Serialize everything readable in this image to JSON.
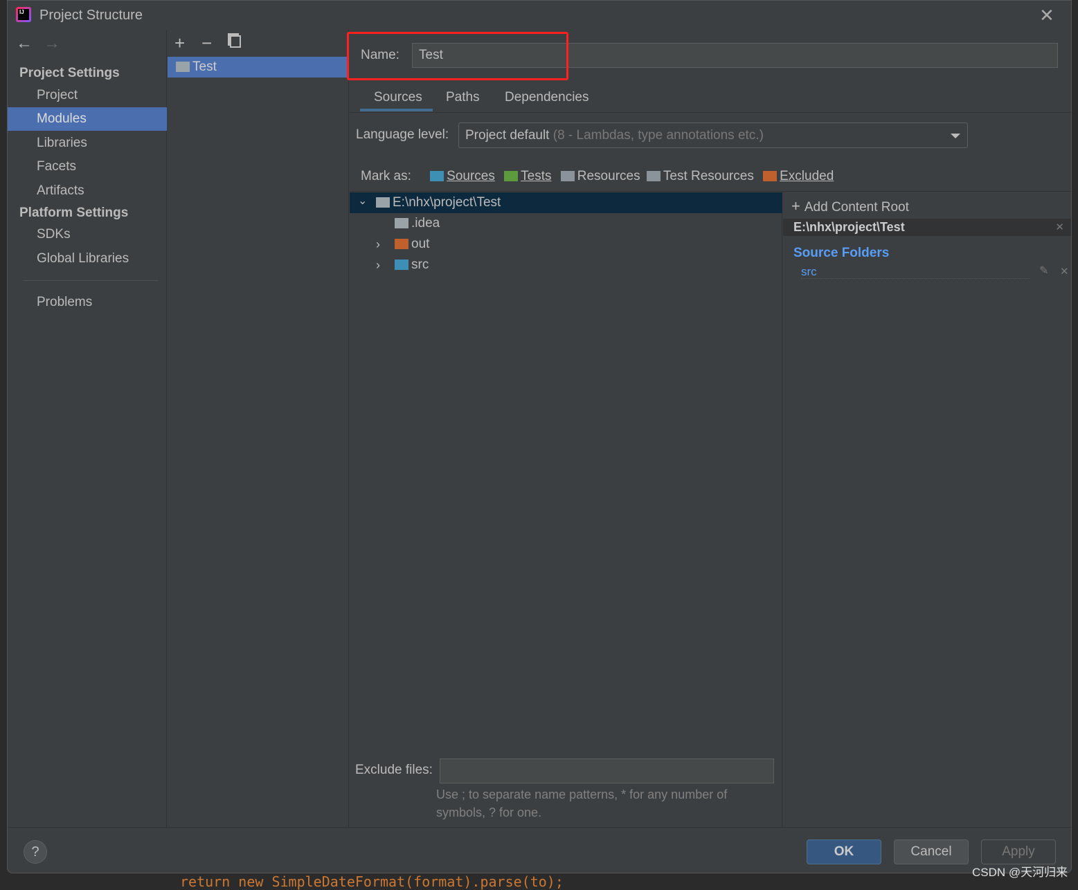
{
  "window": {
    "title": "Project Structure",
    "close_icon": "close-icon",
    "logo": "IJ"
  },
  "background_editor": {
    "code": "return new SimpleDateFormat(format).parse(to);"
  },
  "sidebar": {
    "back_icon": "arrow-left-icon",
    "forward_icon": "arrow-right-icon",
    "project_settings_header": "Project Settings",
    "project_items": [
      {
        "label": "Project"
      },
      {
        "label": "Modules",
        "selected": true
      },
      {
        "label": "Libraries"
      },
      {
        "label": "Facets"
      },
      {
        "label": "Artifacts"
      }
    ],
    "platform_settings_header": "Platform Settings",
    "platform_items": [
      {
        "label": "SDKs"
      },
      {
        "label": "Global Libraries"
      }
    ],
    "problems": "Problems"
  },
  "modules": {
    "add_icon": "plus-icon",
    "remove_icon": "minus-icon",
    "copy_icon": "copy-icon",
    "items": [
      {
        "label": "Test",
        "selected": true
      }
    ]
  },
  "module": {
    "name_label": "Name:",
    "name_value": "Test",
    "tabs": [
      {
        "label": "Sources",
        "active": true
      },
      {
        "label": "Paths"
      },
      {
        "label": "Dependencies"
      }
    ],
    "language_level_label": "Language level:",
    "language_level_value": "Project default",
    "language_level_hint": "(8 - Lambdas, type annotations etc.)",
    "mark_as_label": "Mark as:",
    "mark_as": [
      {
        "label": "Sources",
        "color": "#3d8fb5"
      },
      {
        "label": "Tests",
        "color": "#5c9a3d"
      },
      {
        "label": "Resources",
        "color": "#8a9399"
      },
      {
        "label": "Test Resources",
        "color": "#8a9399"
      },
      {
        "label": "Excluded",
        "color": "#c0602d"
      }
    ],
    "tree": [
      {
        "label": "E:\\nhx\\project\\Test",
        "expanded": true,
        "selected": true,
        "color": "#9aa3a8"
      },
      {
        "label": ".idea",
        "color": "#9aa3a8"
      },
      {
        "label": "out",
        "color": "#c0602d"
      },
      {
        "label": "src",
        "color": "#3d8fb5"
      }
    ],
    "exclude_files_label": "Exclude files:",
    "exclude_files_value": "",
    "exclude_hint_1": "Use ; to separate name patterns, * for any number of",
    "exclude_hint_2": "symbols, ? for one."
  },
  "content_root": {
    "add_label": "Add Content Root",
    "path": "E:\\nhx\\project\\Test",
    "source_folders_header": "Source Folders",
    "source_folders": [
      "src"
    ]
  },
  "footer": {
    "help": "?",
    "ok": "OK",
    "cancel": "Cancel",
    "apply": "Apply"
  },
  "watermark": "CSDN @天河归来",
  "colors": {
    "accent": "#4b6eaf",
    "highlight_box": "#ff2020",
    "link": "#589df6"
  }
}
